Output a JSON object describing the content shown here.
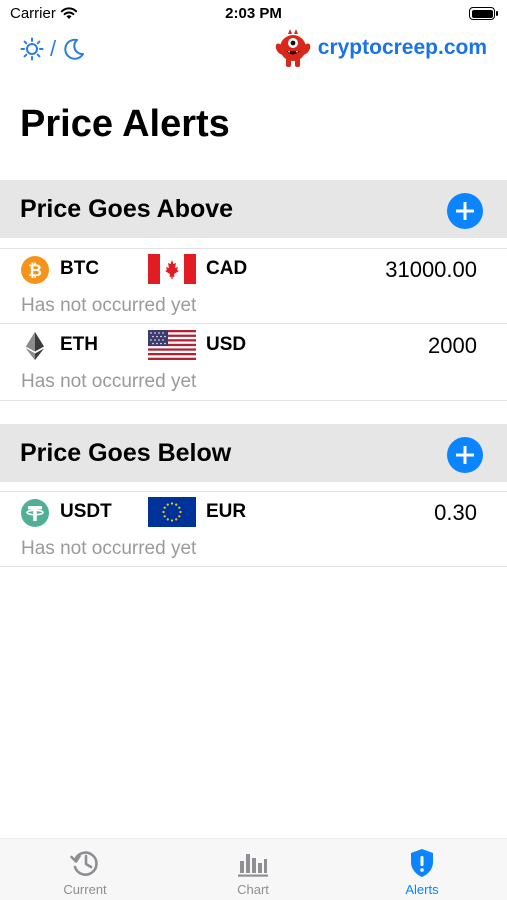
{
  "status_bar": {
    "carrier": "Carrier",
    "time": "2:03 PM"
  },
  "header": {
    "theme_separator": "/",
    "brand": "cryptocreep.com"
  },
  "page_title": "Price Alerts",
  "sections": [
    {
      "title": "Price Goes Above",
      "alerts": [
        {
          "coin": "BTC",
          "fiat": "CAD",
          "price": "31000.00",
          "status": "Has not occurred yet"
        },
        {
          "coin": "ETH",
          "fiat": "USD",
          "price": "2000",
          "status": "Has not occurred yet"
        }
      ]
    },
    {
      "title": "Price Goes Below",
      "alerts": [
        {
          "coin": "USDT",
          "fiat": "EUR",
          "price": "0.30",
          "status": "Has not occurred yet"
        }
      ]
    }
  ],
  "tabs": [
    {
      "label": "Current",
      "icon": "history-icon",
      "active": false
    },
    {
      "label": "Chart",
      "icon": "bar-chart-icon",
      "active": false
    },
    {
      "label": "Alerts",
      "icon": "shield-alert-icon",
      "active": true
    }
  ],
  "colors": {
    "accent": "#0a84ff",
    "brand": "#1a73e8",
    "btc": "#f7931a",
    "usdt": "#50af95"
  }
}
